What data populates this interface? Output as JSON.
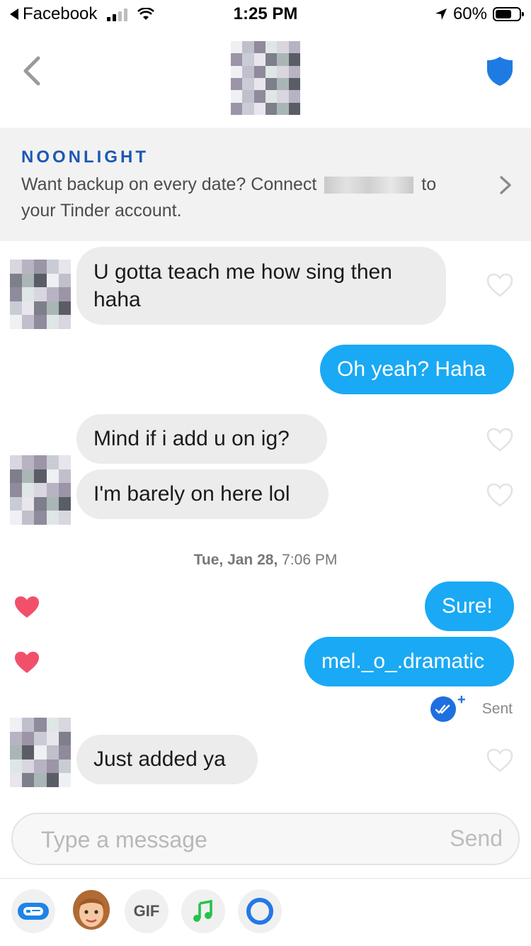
{
  "status_bar": {
    "back_app": "Facebook",
    "time": "1:25 PM",
    "battery": "60%"
  },
  "noonlight": {
    "brand": "NOONLIGHT",
    "text_before": "Want backup on every date? Connect",
    "text_after": "to your Tinder account."
  },
  "messages": [
    {
      "side": "in",
      "text": "U gotta teach me how sing then haha"
    },
    {
      "side": "out",
      "text": "Oh yeah? Haha"
    },
    {
      "side": "in",
      "text": "Mind if i add u on ig?"
    },
    {
      "side": "in",
      "text": "I'm barely on here lol"
    },
    {
      "side": "out",
      "text": "Sure!",
      "liked": true
    },
    {
      "side": "out",
      "text": "mel._o_.dramatic",
      "liked": true
    },
    {
      "side": "in",
      "text": "Just added ya"
    }
  ],
  "date_separator": {
    "date": "Tue, Jan 28,",
    "time": "7:06 PM"
  },
  "receipt": {
    "status": "Sent",
    "plus": "+"
  },
  "composer": {
    "placeholder": "Type a message",
    "send_label": "Send"
  },
  "toolbar": {
    "gif_label": "GIF"
  },
  "colors": {
    "accent": "#1aa9f4",
    "heart": "#f2506a",
    "brand": "#1e57b4",
    "incoming": "#ececec"
  },
  "icons": [
    "back-chevron-icon",
    "shield-icon",
    "chevron-right-icon",
    "heart-outline-icon",
    "heart-filled-icon",
    "double-check-icon",
    "chat-card-icon",
    "bitmoji-icon",
    "music-icon",
    "ring-icon"
  ]
}
